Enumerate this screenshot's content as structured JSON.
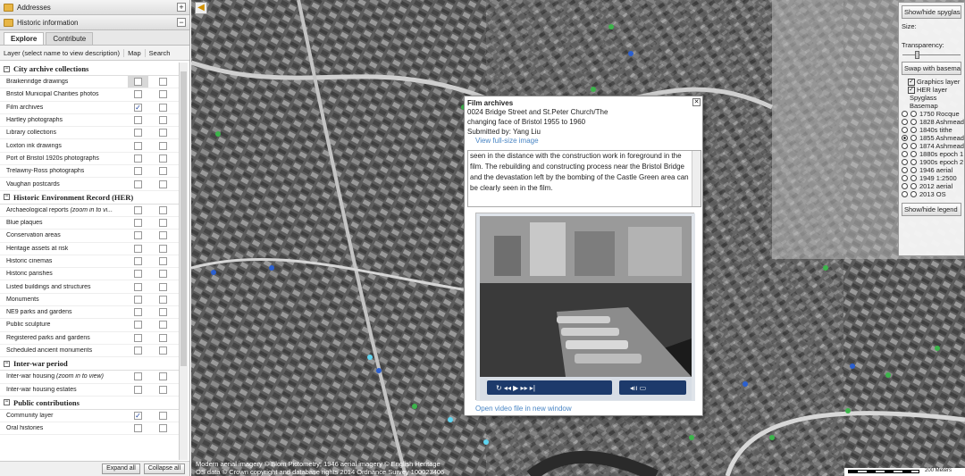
{
  "sidebar": {
    "accordions": [
      {
        "label": "Addresses",
        "toggle": "+"
      },
      {
        "label": "Historic information",
        "toggle": "−"
      }
    ],
    "tabs": [
      "Explore",
      "Contribute"
    ],
    "columns": [
      "Layer (select name to view description)",
      "Map",
      "Search"
    ],
    "groups": [
      {
        "label": "City archive collections",
        "items": [
          {
            "label": "Braikenridge drawings",
            "map": false,
            "search": false,
            "highlight": true
          },
          {
            "label": "Bristol Municipal Charities photos",
            "map": false,
            "search": false
          },
          {
            "label": "Film archives",
            "map": true,
            "search": false
          },
          {
            "label": "Hartley photographs",
            "map": false,
            "search": false
          },
          {
            "label": "Library collections",
            "map": false,
            "search": false
          },
          {
            "label": "Loxton ink drawings",
            "map": false,
            "search": false
          },
          {
            "label": "Port of Bristol 1920s photographs",
            "map": false,
            "search": false
          },
          {
            "label": "Trelawny-Ross photographs",
            "map": false,
            "search": false
          },
          {
            "label": "Vaughan postcards",
            "map": false,
            "search": false
          }
        ]
      },
      {
        "label": "Historic Environment Record (HER)",
        "items": [
          {
            "label": "Archaeological reports",
            "suffix": " (zoom in to vi...",
            "map": false,
            "search": false
          },
          {
            "label": "Blue plaques",
            "map": false,
            "search": false
          },
          {
            "label": "Conservation areas",
            "map": false,
            "search": false
          },
          {
            "label": "Heritage assets at risk",
            "map": false,
            "search": false
          },
          {
            "label": "Historic cinemas",
            "map": false,
            "search": false
          },
          {
            "label": "Historic parishes",
            "map": false,
            "search": false
          },
          {
            "label": "Listed buildings and structures",
            "map": false,
            "search": false
          },
          {
            "label": "Monuments",
            "map": false,
            "search": false
          },
          {
            "label": "NE9 parks and gardens",
            "map": false,
            "search": false
          },
          {
            "label": "Public sculpture",
            "map": false,
            "search": false
          },
          {
            "label": "Registered parks and gardens",
            "map": false,
            "search": false
          },
          {
            "label": "Scheduled ancient monuments",
            "map": false,
            "search": false
          }
        ]
      },
      {
        "label": "Inter-war period",
        "items": [
          {
            "label": "Inter-war housing",
            "suffix": " (zoom in to view)",
            "map": false,
            "search": false
          },
          {
            "label": "Inter-war housing estates",
            "map": false,
            "search": false
          }
        ]
      },
      {
        "label": "Public contributions",
        "items": [
          {
            "label": "Community layer",
            "map": true,
            "search": false
          },
          {
            "label": "Oral histories",
            "map": false,
            "search": false
          }
        ]
      }
    ],
    "buttons": {
      "expand": "Expand all",
      "collapse": "Collapse all"
    }
  },
  "map": {
    "collapse_glyph": "◀",
    "attribution_1": "Modern aerial imagery © Blom Pictometry; 1946 aerial imagery © English Heritage",
    "attribution_2": "OS data © Crown copyright and database rights 2014 Ordnance Survey 100023406",
    "scale_label": "200 Meters"
  },
  "spyglass": {
    "toggle": "Show/hide spyglass",
    "size_label": "Size:",
    "transparency_label": "Transparency:",
    "swap": "Swap with basemap",
    "checks": [
      {
        "label": "Graphics layer",
        "checked": true
      },
      {
        "label": "HER layer",
        "checked": true
      }
    ],
    "sub_labels": [
      "Spyglass",
      "Basemap"
    ],
    "layers": [
      "1750 Rocque",
      "1828 Ashmead",
      "1840s tithe",
      "1855 Ashmead",
      "1874 Ashmead",
      "1880s epoch 1",
      "1900s epoch 2",
      "1946 aerial",
      "1949 1:2500",
      "2012 aerial",
      "2013 OS"
    ],
    "selected_layer": "1855 Ashmead",
    "legend": "Show/hide legend"
  },
  "popup": {
    "title": "Film archives",
    "line1": "0024  Bridge Street and St.Peter Church/The",
    "line2": "changing face of Bristol 1955 to 1960",
    "submitted": "Submitted by: Yang Liu",
    "full_link": "View full-size image",
    "description": "seen in the distance with the construction work in foreground in the film. The rebuilding and constructing process near the Bristol Bridge and the devastation left by the bombing of the Castle Green area can be clearly seen in the film.",
    "video_link": "Open video file in new window"
  }
}
